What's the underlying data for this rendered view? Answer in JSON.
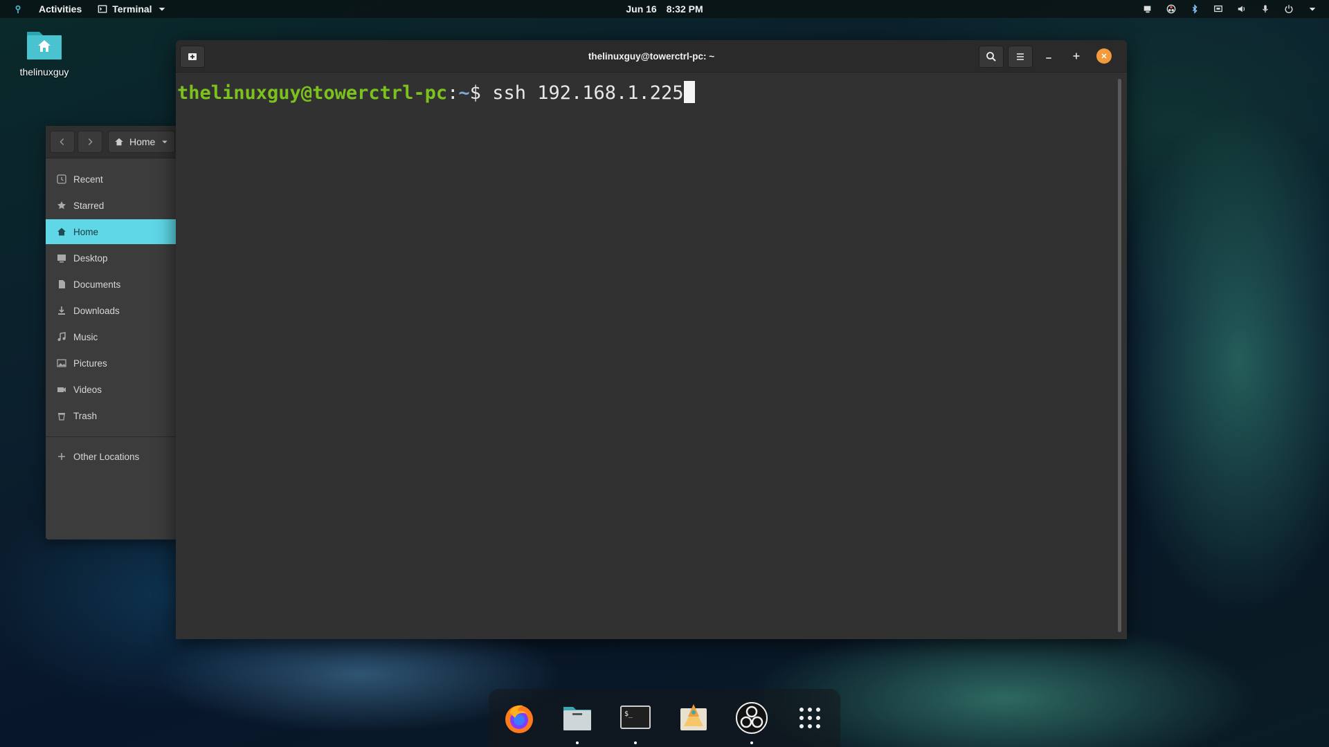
{
  "topbar": {
    "activities": "Activities",
    "app_menu": "Terminal",
    "date": "Jun 16",
    "time": "8:32 PM"
  },
  "desktop": {
    "home_icon_label": "thelinuxguy"
  },
  "files": {
    "path_label": "Home",
    "sidebar": [
      {
        "label": "Recent",
        "icon": "clock-icon"
      },
      {
        "label": "Starred",
        "icon": "star-icon"
      },
      {
        "label": "Home",
        "icon": "home-icon",
        "active": true
      },
      {
        "label": "Desktop",
        "icon": "desktop-icon"
      },
      {
        "label": "Documents",
        "icon": "document-icon"
      },
      {
        "label": "Downloads",
        "icon": "download-icon"
      },
      {
        "label": "Music",
        "icon": "music-icon"
      },
      {
        "label": "Pictures",
        "icon": "picture-icon"
      },
      {
        "label": "Videos",
        "icon": "video-icon"
      },
      {
        "label": "Trash",
        "icon": "trash-icon"
      }
    ],
    "other_locations": "Other Locations"
  },
  "terminal": {
    "title": "thelinuxguy@towerctrl-pc: ~",
    "prompt_user": "thelinuxguy@towerctrl-pc",
    "prompt_colon": ":",
    "prompt_path": "~",
    "prompt_symbol": "$",
    "command": " ssh 192.168.1.225"
  },
  "dock": {
    "apps": [
      "firefox-icon",
      "files-icon",
      "terminal-icon",
      "software-icon",
      "obs-icon",
      "app-grid-icon"
    ]
  },
  "colors": {
    "accent": "#5fd7e6",
    "prompt_green": "#7cc21f",
    "close_button": "#f29b3a"
  }
}
